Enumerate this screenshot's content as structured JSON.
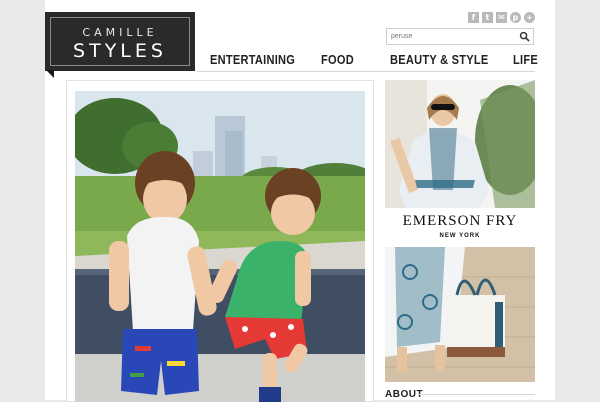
{
  "logo": {
    "top": "CAMILLE",
    "bottom": "STYLES"
  },
  "social": [
    {
      "icon": "facebook-icon",
      "glyph": "f"
    },
    {
      "icon": "twitter-icon",
      "glyph": "t"
    },
    {
      "icon": "email-icon",
      "glyph": "✉"
    },
    {
      "icon": "pinterest-icon",
      "glyph": "p"
    },
    {
      "icon": "rss-icon",
      "glyph": "+"
    }
  ],
  "search": {
    "placeholder": "peruse"
  },
  "nav": {
    "entertaining": "ENTERTAINING",
    "food": "FOOD",
    "beauty": "BEAUTY & STYLE",
    "life": "LIFE"
  },
  "ad": {
    "brand": "EMERSON FRY",
    "sub": "NEW YORK"
  },
  "sidebar": {
    "about": "ABOUT"
  },
  "colors": {
    "logo_bg": "#2a2a2a",
    "page_bg": "#e9e9e9",
    "accent_text": "#222222"
  }
}
